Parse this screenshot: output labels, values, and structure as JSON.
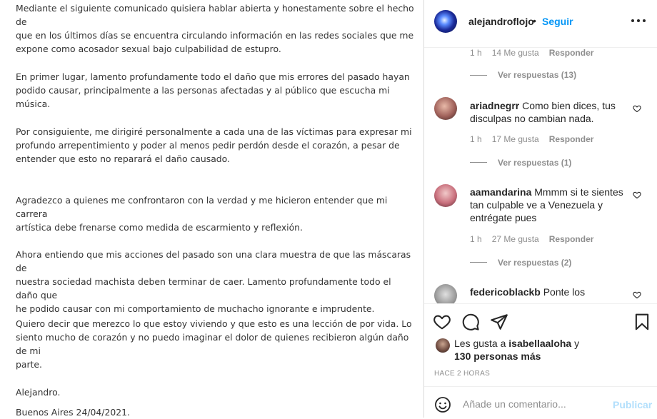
{
  "post": {
    "paragraphs": [
      [
        "Mediante el siguiente comunicado quisiera hablar abierta y honestamente sobre el hecho de",
        "que en los últimos días se encuentra circulando información en las redes sociales que me",
        "expone como acosador sexual bajo culpabilidad de estupro."
      ],
      [
        "En primer lugar, lamento profundamente todo el daño que mis errores del pasado hayan",
        "podido causar, principalmente a las personas afectadas y al público que escucha mi música."
      ],
      [
        "Por consiguiente, me dirigiré personalmente a cada una de las víctimas para expresar mi",
        "profundo arrepentimiento y poder al menos pedir perdón desde el corazón, a pesar de",
        "entender que esto no reparará el daño causado."
      ],
      [
        "Agradezco a quienes me confrontaron con la verdad y me hicieron entender que mi carrera",
        "artística debe frenarse como medida de escarmiento y reflexión."
      ],
      [
        "Ahora entiendo que mis acciones del pasado son una clara muestra de que las máscaras de",
        "nuestra sociedad machista deben terminar de caer. Lamento profundamente todo el daño que",
        "he podido causar con mi comportamiento de muchacho ignorante e imprudente."
      ],
      [
        "Quiero decir que merezco lo que estoy viviendo y que esto es una lección de por vida. Lo",
        "siento mucho de corazón y no puedo imaginar el dolor de quienes recibieron algún daño de mi",
        "parte."
      ],
      [
        "Alejandro."
      ],
      [
        "Buenos Aires 24/04/2021."
      ]
    ]
  },
  "header": {
    "username": "alejandroflojo",
    "separator": "•",
    "follow_label": "Seguir",
    "more_icon": "more-options-icon"
  },
  "comments": {
    "top_meta": {
      "time": "1 h",
      "likes": "14 Me gusta",
      "reply": "Responder"
    },
    "top_view_replies": "Ver respuestas (13)",
    "items": [
      {
        "username": "ariadnegrr",
        "text": "Como bien dices, tus disculpas no cambian nada.",
        "time": "1 h",
        "likes": "17 Me gusta",
        "reply": "Responder",
        "view_replies": "Ver respuestas (1)"
      },
      {
        "username": "aamandarina",
        "text": "Mmmm si te sientes tan culpable ve a Venezuela y entrégate pues",
        "time": "1 h",
        "likes": "27 Me gusta",
        "reply": "Responder",
        "view_replies": "Ver respuestas (2)"
      },
      {
        "username": "federicoblackb",
        "text": "Ponte los"
      }
    ]
  },
  "actions": {
    "likes_prefix": "Les gusta a",
    "likes_user": "isabellaaloha",
    "likes_conj": "y",
    "likes_count": "130 personas más",
    "timestamp": "HACE 2 HORAS"
  },
  "add_comment": {
    "placeholder": "Añade un comentario...",
    "publish_label": "Publicar"
  },
  "colors": {
    "link_blue": "#0095f6",
    "publish_disabled": "#b2dffc",
    "secondary_text": "#8e8e8e"
  }
}
